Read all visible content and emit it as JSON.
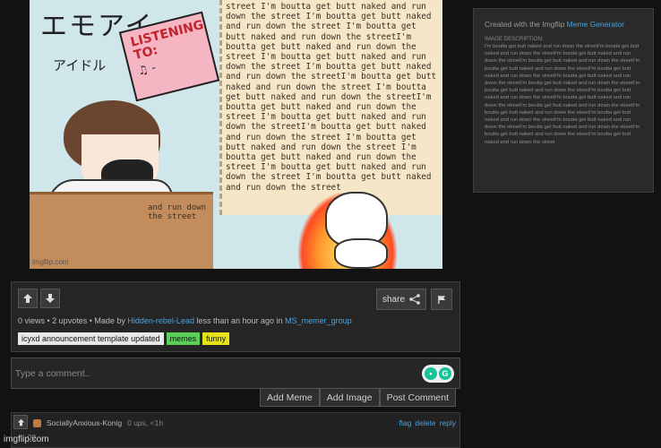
{
  "meme": {
    "title_jp": "エモアイ",
    "subtitle_jp": "アイドル",
    "note_line1": "LISTENING",
    "note_line2": "TO:",
    "note_line3": "♫ -",
    "paper_text": "street I'm boutta get butt naked and run down the street I'm boutta get butt naked and run down the street I'm boutta get butt naked and run down the streetI'm boutta get butt naked and run down the street I'm boutta get butt naked and run down the street I'm boutta get butt naked and run down the streetI'm boutta get butt naked and run down the street I'm boutta get butt naked and run down the streetI'm boutta get butt naked and run down the street I'm boutta get butt naked and run down the streetI'm boutta get butt naked and run down the street I'm boutta get butt naked and run down the street I'm boutta get butt naked and run down the street I'm boutta get butt naked and run down the street I'm boutta get butt naked and run down the street",
    "desk_text": "and run down the street",
    "watermark": "imgflip.com"
  },
  "description_panel": {
    "created_prefix": "Created with the Imgflip ",
    "created_link": "Meme Generator",
    "heading": "IMAGE DESCRIPTION:",
    "text": "I'm boutta get butt naked and run down the streetI'm boutta get butt naked and run down the streetI'm boutta get butt naked and run down the streetI'm boutta get butt naked and run down the streetI'm boutta get butt naked and run down the streetI'm boutta get butt naked and run down the streetI'm boutta get butt naked and run down the streetI'm boutta get butt naked and run down the streetI'm boutta get butt naked and run down the streetI'm boutta get butt naked and run down the streetI'm boutta get butt naked and run down the streetI'm boutta get butt naked and run down the streetI'm boutta get butt naked and run down the streetI'm boutta get butt naked and run down the streetI'm boutta get butt naked and run down the streetI'm boutta get butt naked and run down the streetI'm boutta get butt naked and run down the streetI'm boutta get butt naked and run down the street"
  },
  "meme_info": {
    "share_label": "share",
    "views": "0 views",
    "upvotes": "2 upvotes",
    "made_by": "Made by",
    "author": "Hidden-rebel-Lead",
    "time": "less than an hour ago in",
    "stream": "MS_memer_group",
    "tags": [
      {
        "label": "icyxd announcement template updated",
        "color": "#e8e8e8"
      },
      {
        "label": "memes",
        "color": "#5ad05a"
      },
      {
        "label": "funny",
        "color": "#e6e21a"
      }
    ]
  },
  "comment_form": {
    "placeholder": "Type a comment..",
    "add_meme": "Add Meme",
    "add_image": "Add Image",
    "post_comment": "Post Comment"
  },
  "comment": {
    "author": "SociallyAnxious-Konig",
    "meta": "0 ups, <1h",
    "flag": "flag",
    "delete": "delete",
    "reply": "reply",
    "score_partial": "00"
  },
  "footer": {
    "watermark": "imgflip.com"
  },
  "colors": {
    "background": "#121212",
    "link": "#4aa3df",
    "panel": "#252525"
  }
}
